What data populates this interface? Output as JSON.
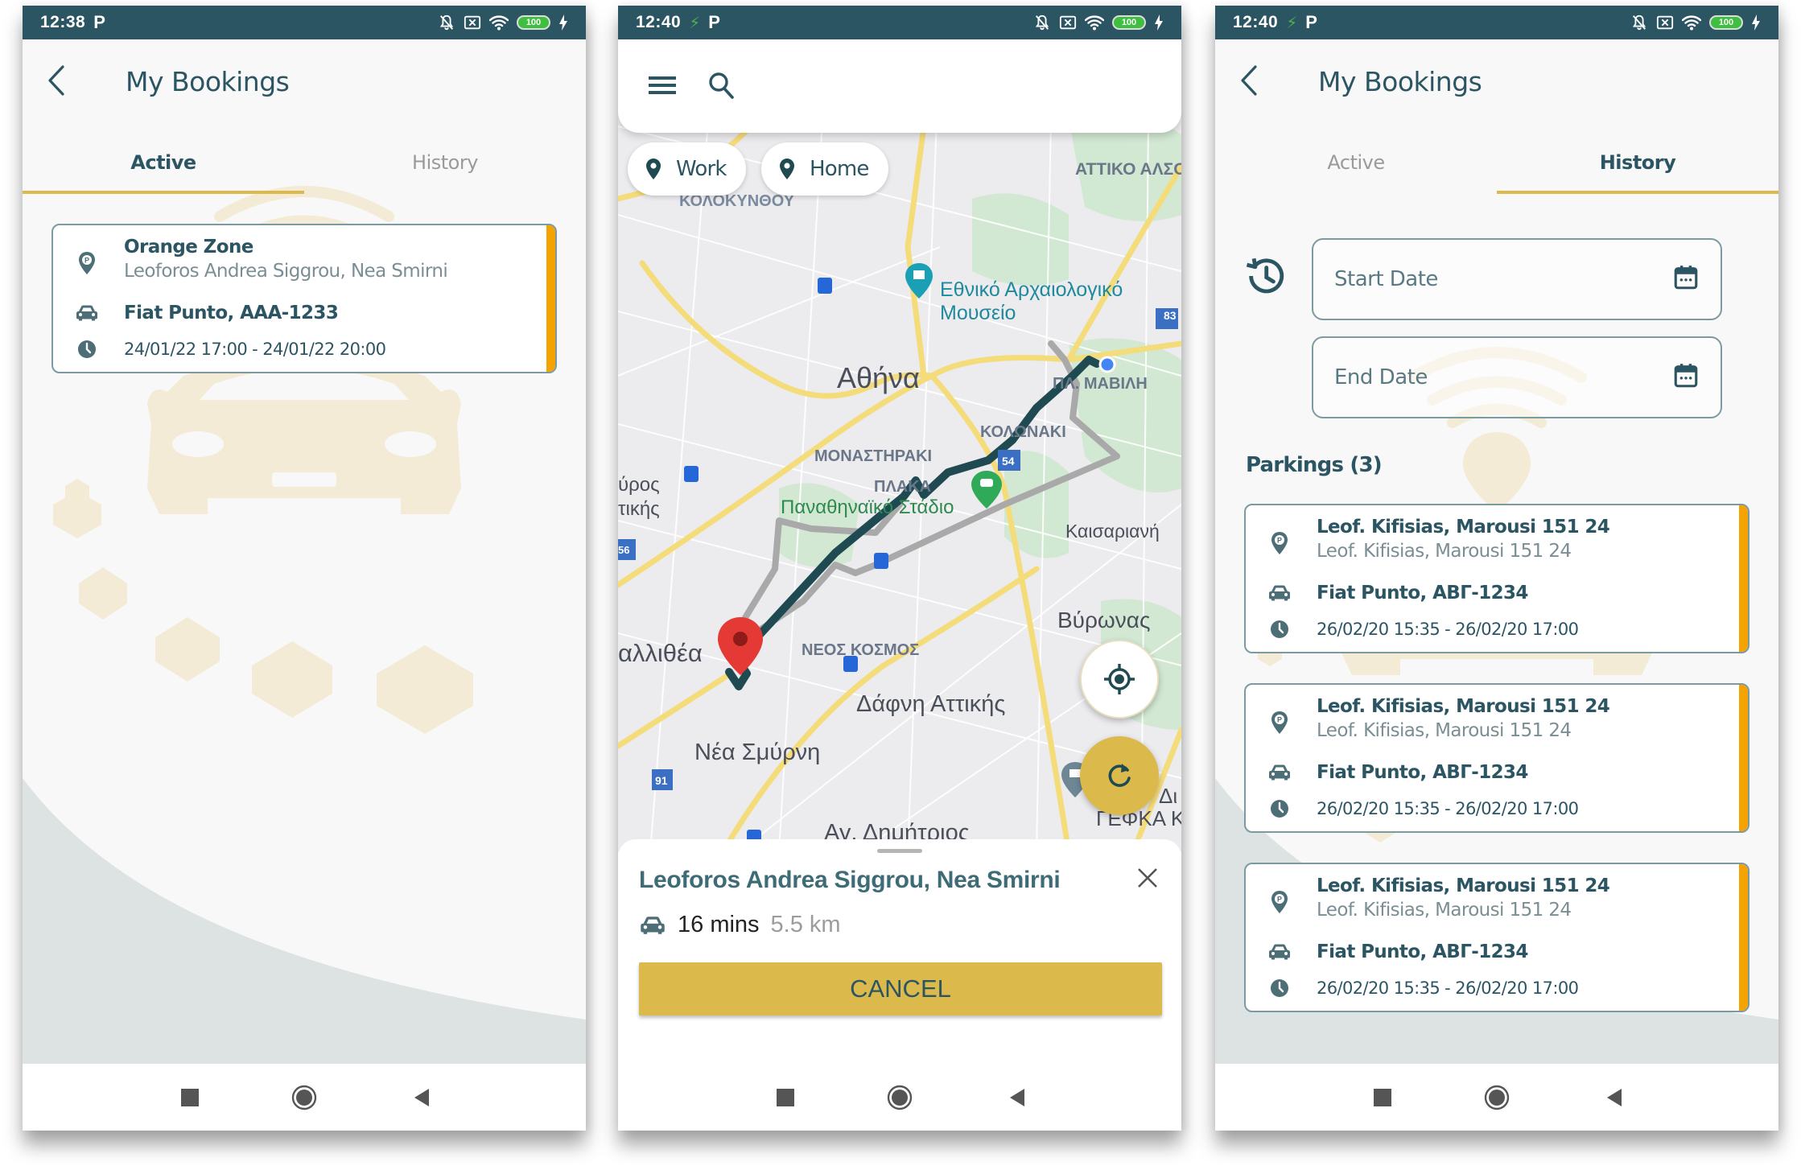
{
  "status_bars": [
    {
      "time": "12:38",
      "notif_icons": [
        "parking-p-icon"
      ],
      "battery": "100"
    },
    {
      "time": "12:40",
      "notif_icons": [
        "sync-off-icon",
        "parking-p-icon"
      ],
      "battery": "100"
    },
    {
      "time": "12:40",
      "notif_icons": [
        "sync-off-icon",
        "parking-p-icon"
      ],
      "battery": "100"
    }
  ],
  "screen1": {
    "title": "My Bookings",
    "tabs": [
      {
        "label": "Active",
        "active": true
      },
      {
        "label": "History",
        "active": false
      }
    ],
    "booking": {
      "zone": "Orange Zone",
      "address": "Leoforos Andrea Siggrou, Nea Smirni",
      "vehicle": "Fiat Punto, AAA-1233",
      "period": "24/01/22 17:00 - 24/01/22 20:00"
    }
  },
  "screen2": {
    "search": {
      "menu_icon": "hamburger-menu-icon",
      "search_icon": "search-icon",
      "placeholder": ""
    },
    "chips": [
      {
        "label": "Work",
        "icon": "location-pin-icon"
      },
      {
        "label": "Home",
        "icon": "location-pin-icon"
      }
    ],
    "map_labels": {
      "attiko": "ΑΤΤΙΚΟ ΑΛΣΟ",
      "kolokynthou": "ΚΟΛΟΚΥΝΘΟΥ",
      "museum_line1": "Εθνικό Αρχαιολογικό",
      "museum_line2": "Μουσείο",
      "athina": "Αθήνα",
      "mavili": "ΠΛ. ΜΑΒΙΛΗ",
      "kolonaki": "ΚΟΛΩΝΑΚΙ",
      "monastiraki": "ΜΟΝΑΣΤΗΡΑΚΙ",
      "plaka": "ΠΛΑΚΑ",
      "stadio": "Παναθηναϊκό Στάδιο",
      "tavros1": "ύρος",
      "tavros2": "τικής",
      "kaisariani": "Καισαριανή",
      "vyronas": "Βύρωνας",
      "kallithea": "αλλιθέα",
      "neos_kosmos": "ΝΕΟΣ ΚΟΣΜΟΣ",
      "dafni": "Δάφνη Αττικής",
      "nea_smyrni": "Νέα Σμύρνη",
      "ag_dimitrios": "Αγ. Δημήτριος",
      "efka1": "Δι",
      "efka2": "ΓΕΦΚΑ Κε",
      "road83": "83",
      "road54": "54",
      "road56": "56",
      "road91": "91"
    },
    "sheet": {
      "destination": "Leoforos Andrea Siggrou, Nea Smirni",
      "duration": "16 mins",
      "distance": "5.5 km",
      "cancel_label": "CANCEL"
    },
    "colors": {
      "route": "#1f4a52",
      "alt_route": "#a9a9a9",
      "accent": "#dcb94b",
      "destination_pin": "#e53935"
    }
  },
  "screen3": {
    "title": "My Bookings",
    "tabs": [
      {
        "label": "Active",
        "active": false
      },
      {
        "label": "History",
        "active": true
      }
    ],
    "start_date_placeholder": "Start Date",
    "end_date_placeholder": "End Date",
    "section_title": "Parkings (3)",
    "parkings": [
      {
        "title": "Leof. Kifisias, Marousi 151 24",
        "address": "Leof. Kifisias, Marousi 151 24",
        "vehicle": "Fiat Punto, ΑΒΓ-1234",
        "period": "26/02/20 15:35 - 26/02/20 17:00"
      },
      {
        "title": "Leof. Kifisias, Marousi 151 24",
        "address": "Leof. Kifisias, Marousi 151 24",
        "vehicle": "Fiat Punto, ΑΒΓ-1234",
        "period": "26/02/20 15:35 - 26/02/20 17:00"
      },
      {
        "title": "Leof. Kifisias, Marousi 151 24",
        "address": "Leof. Kifisias, Marousi 151 24",
        "vehicle": "Fiat Punto, ΑΒΓ-1234",
        "period": "26/02/20 15:35 - 26/02/20 17:00"
      }
    ]
  },
  "theme": {
    "primary": "#2c5563",
    "accent": "#dcb94b",
    "card_accent": "#f5a300",
    "background": "#f8f8f8"
  }
}
